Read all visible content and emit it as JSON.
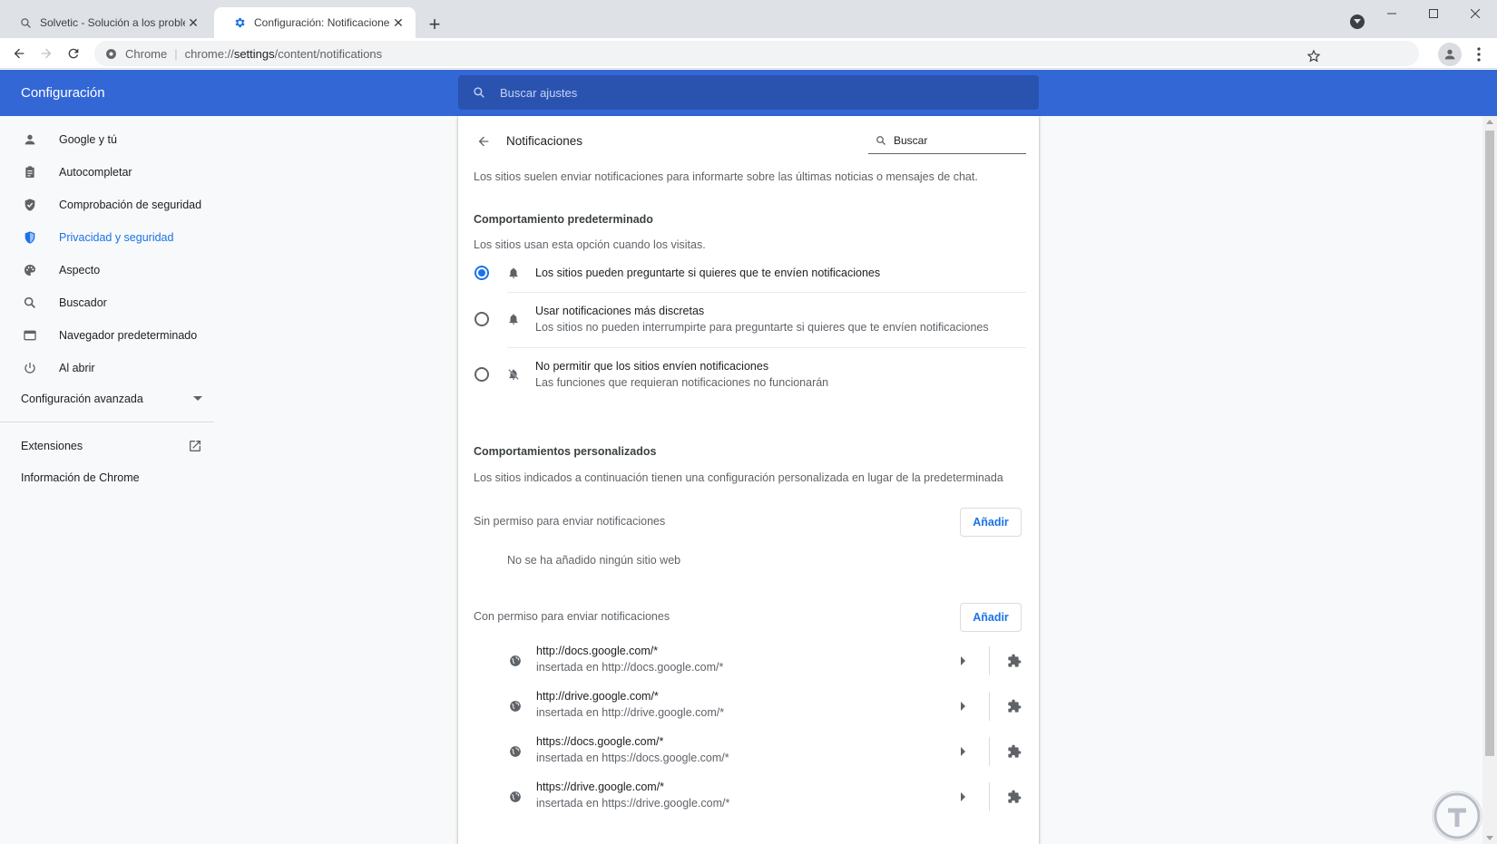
{
  "browser": {
    "tabs": [
      {
        "title": "Solvetic - Solución a los problem",
        "active": false,
        "icon": "search-icon"
      },
      {
        "title": "Configuración: Notificaciones",
        "active": true,
        "icon": "gear-icon"
      }
    ],
    "omnibox": {
      "chip": "Chrome",
      "scheme": "chrome://",
      "host": "settings",
      "path": "/content/notifications"
    }
  },
  "header": {
    "title": "Configuración",
    "search_placeholder": "Buscar ajustes"
  },
  "sidebar": {
    "items": [
      {
        "label": "Google y tú",
        "icon": "person-icon"
      },
      {
        "label": "Autocompletar",
        "icon": "clipboard-icon"
      },
      {
        "label": "Comprobación de seguridad",
        "icon": "shield-check-icon"
      },
      {
        "label": "Privacidad y seguridad",
        "icon": "shield-icon",
        "selected": true
      },
      {
        "label": "Aspecto",
        "icon": "palette-icon"
      },
      {
        "label": "Buscador",
        "icon": "search-icon"
      },
      {
        "label": "Navegador predeterminado",
        "icon": "browser-icon"
      },
      {
        "label": "Al abrir",
        "icon": "power-icon"
      }
    ],
    "advanced": "Configuración avanzada",
    "extensions": "Extensiones",
    "about": "Información de Chrome"
  },
  "main": {
    "title": "Notificaciones",
    "search_placeholder": "Buscar",
    "intro": "Los sitios suelen enviar notificaciones para informarte sobre las últimas noticias o mensajes de chat.",
    "default_heading": "Comportamiento predeterminado",
    "default_desc": "Los sitios usan esta opción cuando los visitas.",
    "options": [
      {
        "label": "Los sitios pueden preguntarte si quieres que te envíen notificaciones",
        "sublabel": "",
        "checked": true,
        "icon": "bell-icon"
      },
      {
        "label": "Usar notificaciones más discretas",
        "sublabel": "Los sitios no pueden interrumpirte para preguntarte si quieres que te envíen notificaciones",
        "checked": false,
        "icon": "bell-icon"
      },
      {
        "label": "No permitir que los sitios envíen notificaciones",
        "sublabel": "Las funciones que requieran notificaciones no funcionarán",
        "checked": false,
        "icon": "bell-off-icon"
      }
    ],
    "custom_heading": "Comportamientos personalizados",
    "custom_desc": "Los sitios indicados a continuación tienen una configuración personalizada en lugar de la predeterminada",
    "blocked": {
      "label": "Sin permiso para enviar notificaciones",
      "add": "Añadir",
      "empty": "No se ha añadido ningún sitio web"
    },
    "allowed": {
      "label": "Con permiso para enviar notificaciones",
      "add": "Añadir",
      "sites": [
        {
          "host": "http://docs.google.com/*",
          "embedded": "insertada en http://docs.google.com/*"
        },
        {
          "host": "http://drive.google.com/*",
          "embedded": "insertada en http://drive.google.com/*"
        },
        {
          "host": "https://docs.google.com/*",
          "embedded": "insertada en https://docs.google.com/*"
        },
        {
          "host": "https://drive.google.com/*",
          "embedded": "insertada en https://drive.google.com/*"
        }
      ]
    }
  },
  "colors": {
    "accent": "#1a73e8",
    "header_bg": "#3367d6"
  }
}
